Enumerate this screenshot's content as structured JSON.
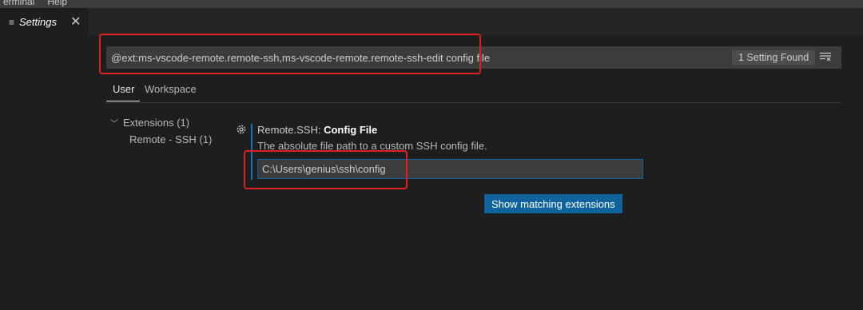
{
  "titlebar": {
    "menu": [
      "erminal",
      "Help"
    ]
  },
  "tab": {
    "label": "Settings",
    "icon": "settings-list-icon",
    "close_icon": "close-icon",
    "close_glyph": "✕"
  },
  "search": {
    "value": "@ext:ms-vscode-remote.remote-ssh,ms-vscode-remote.remote-ssh-edit config file",
    "count": "1 Setting Found",
    "filter_icon": "clear-filter-icon"
  },
  "scope_tabs": [
    "User",
    "Workspace"
  ],
  "toc": {
    "extensions": "Extensions (1)",
    "remote_ssh": "Remote - SSH (1)"
  },
  "setting": {
    "category": "Remote.SSH: ",
    "name": "Config File",
    "description": "The absolute file path to a custom SSH config file.",
    "value": "C:\\Users\\genius\\ssh\\config",
    "gear_icon": "gear-icon"
  },
  "button": {
    "label": "Show matching extensions"
  },
  "colors": {
    "accent": "#0e639c",
    "highlight": "#e02020",
    "background": "#1e1e1e"
  }
}
